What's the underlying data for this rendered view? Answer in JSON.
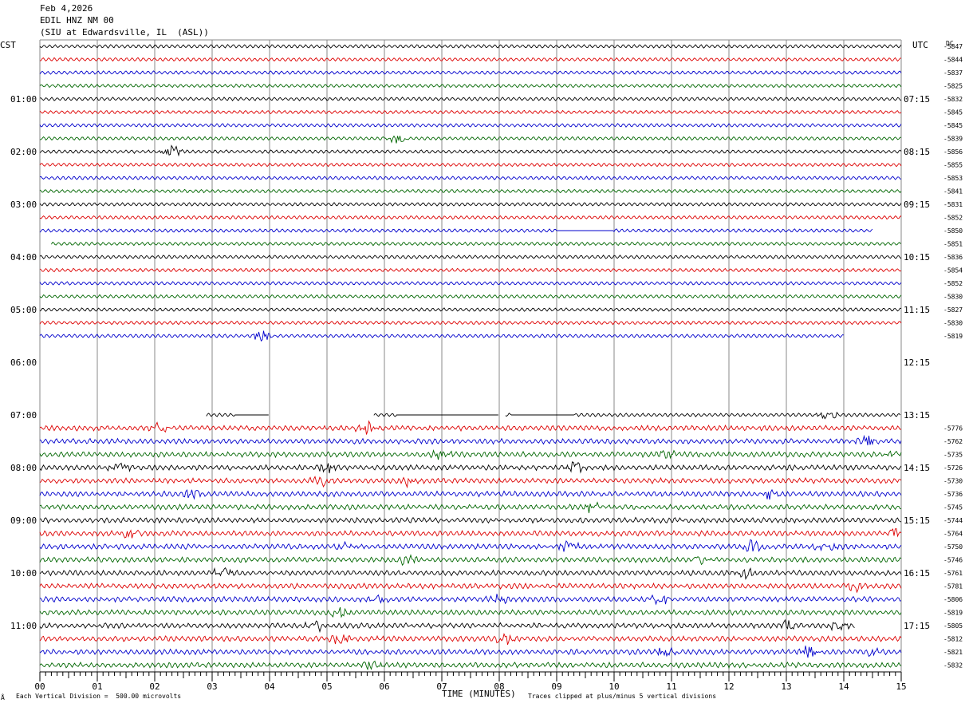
{
  "header": {
    "date": "Feb 4,2026",
    "channel": "EDIL HNZ NM 00",
    "station": "(SIU at Edwardsville, IL  (ASL))"
  },
  "left_tz": "CST",
  "right_tz": "UTC",
  "dc_label": "DC",
  "footer": {
    "scale_note": "Each Vertical Division =  500.00 microvolts",
    "xlabel": "TIME (MINUTES)",
    "clip_note": "Traces clipped at plus/minus 5 vertical divisions",
    "corner_mark": "Å"
  },
  "colors": {
    "black": "#000000",
    "red": "#dd0000",
    "blue": "#0000cc",
    "green": "#006600",
    "grid": "#888888"
  },
  "chart_data": {
    "type": "line",
    "title": "EDIL HNZ NM 00",
    "xlabel": "TIME (MINUTES)",
    "xlim": [
      0,
      15
    ],
    "x_ticks": [
      "00",
      "01",
      "02",
      "03",
      "04",
      "05",
      "06",
      "07",
      "08",
      "09",
      "10",
      "11",
      "12",
      "13",
      "14",
      "15"
    ],
    "left_hour_labels": [
      "01:00",
      "02:00",
      "03:00",
      "04:00",
      "05:00",
      "06:00",
      "07:00",
      "08:00",
      "09:00",
      "10:00",
      "11:00"
    ],
    "right_hour_labels": [
      "07:15",
      "08:15",
      "09:15",
      "10:15",
      "11:15",
      "12:15",
      "13:15",
      "14:15",
      "15:15",
      "16:15",
      "17:15"
    ],
    "trace_color_cycle": [
      "black",
      "red",
      "blue",
      "green"
    ],
    "traces": [
      {
        "row": 0,
        "dc": "-5847",
        "start": 0,
        "end": 15,
        "noise": "low"
      },
      {
        "row": 1,
        "dc": "-5844",
        "start": 0,
        "end": 15,
        "noise": "low"
      },
      {
        "row": 2,
        "dc": "-5837",
        "start": 0,
        "end": 15,
        "noise": "low"
      },
      {
        "row": 3,
        "dc": "-5825",
        "start": 0,
        "end": 15,
        "noise": "low"
      },
      {
        "row": 4,
        "dc": "-5832",
        "start": 0,
        "end": 15,
        "noise": "low"
      },
      {
        "row": 5,
        "dc": "-5845",
        "start": 0,
        "end": 15,
        "noise": "low"
      },
      {
        "row": 6,
        "dc": "-5845",
        "start": 0,
        "end": 15,
        "noise": "low"
      },
      {
        "row": 7,
        "dc": "-5839",
        "start": 0,
        "end": 15,
        "noise": "low",
        "events": [
          6.2
        ]
      },
      {
        "row": 8,
        "dc": "-5856",
        "start": 0,
        "end": 15,
        "noise": "low",
        "events": [
          2.3
        ]
      },
      {
        "row": 9,
        "dc": "-5855",
        "start": 0,
        "end": 15,
        "noise": "low"
      },
      {
        "row": 10,
        "dc": "-5853",
        "start": 0,
        "end": 15,
        "noise": "low"
      },
      {
        "row": 11,
        "dc": "-5841",
        "start": 0,
        "end": 15,
        "noise": "low"
      },
      {
        "row": 12,
        "dc": "-5831",
        "start": 0,
        "end": 15,
        "noise": "low"
      },
      {
        "row": 13,
        "dc": "-5852",
        "start": 0,
        "end": 15,
        "noise": "low"
      },
      {
        "row": 14,
        "dc": "-5850",
        "start": 0,
        "end": 14.5,
        "noise": "low",
        "flat": [
          [
            9,
            10
          ]
        ]
      },
      {
        "row": 15,
        "dc": "-5851",
        "start": 0.2,
        "end": 15,
        "noise": "low"
      },
      {
        "row": 16,
        "dc": "-5836",
        "start": 0,
        "end": 15,
        "noise": "low"
      },
      {
        "row": 17,
        "dc": "-5854",
        "start": 0,
        "end": 15,
        "noise": "low"
      },
      {
        "row": 18,
        "dc": "-5852",
        "start": 0,
        "end": 15,
        "noise": "low"
      },
      {
        "row": 19,
        "dc": "-5830",
        "start": 0,
        "end": 15,
        "noise": "low"
      },
      {
        "row": 20,
        "dc": "-5827",
        "start": 0,
        "end": 15,
        "noise": "low"
      },
      {
        "row": 21,
        "dc": "-5830",
        "start": 0,
        "end": 15,
        "noise": "low"
      },
      {
        "row": 22,
        "dc": "-5819",
        "start": 0,
        "end": 14.0,
        "noise": "low",
        "events": [
          3.9
        ]
      },
      {
        "row": 23,
        "dc": "",
        "start": 0,
        "end": 0,
        "noise": "none"
      },
      {
        "row": 24,
        "dc": "",
        "start": 0,
        "end": 0,
        "noise": "none"
      },
      {
        "row": 25,
        "dc": "",
        "start": 0,
        "end": 0,
        "noise": "none"
      },
      {
        "row": 26,
        "dc": "",
        "start": 0,
        "end": 0,
        "noise": "none"
      },
      {
        "row": 27,
        "dc": "",
        "start": 0,
        "end": 0,
        "noise": "none"
      },
      {
        "row": 28,
        "dc": "",
        "start": 2.9,
        "end": 15,
        "noise": "low",
        "flat": [
          [
            3.4,
            4.0
          ],
          [
            6.2,
            8.0
          ],
          [
            8.2,
            9.3
          ]
        ],
        "gaps": [
          [
            4.0,
            5.8
          ],
          [
            8.0,
            8.1
          ]
        ],
        "events": [
          13.7
        ]
      },
      {
        "row": 29,
        "dc": "-5776",
        "start": 0,
        "end": 15,
        "noise": "high",
        "events": [
          2.1,
          5.7
        ]
      },
      {
        "row": 30,
        "dc": "-5762",
        "start": 0,
        "end": 15,
        "noise": "high",
        "events": [
          14.4
        ]
      },
      {
        "row": 31,
        "dc": "-5735",
        "start": 0,
        "end": 15,
        "noise": "high",
        "events": [
          7.0,
          10.9,
          14.9
        ]
      },
      {
        "row": 32,
        "dc": "-5726",
        "start": 0,
        "end": 15,
        "noise": "high",
        "events": [
          1.4,
          5.0,
          9.3
        ]
      },
      {
        "row": 33,
        "dc": "-5730",
        "start": 0,
        "end": 15,
        "noise": "high",
        "events": [
          4.9,
          6.4
        ]
      },
      {
        "row": 34,
        "dc": "-5736",
        "start": 0,
        "end": 15,
        "noise": "high",
        "events": [
          2.7,
          12.7
        ]
      },
      {
        "row": 35,
        "dc": "-5745",
        "start": 0,
        "end": 15,
        "noise": "high",
        "events": [
          9.6
        ]
      },
      {
        "row": 36,
        "dc": "-5744",
        "start": 0,
        "end": 15,
        "noise": "high"
      },
      {
        "row": 37,
        "dc": "-5764",
        "start": 0,
        "end": 15,
        "noise": "high",
        "events": [
          1.6,
          14.9
        ]
      },
      {
        "row": 38,
        "dc": "-5750",
        "start": 0,
        "end": 15,
        "noise": "high",
        "events": [
          5.3,
          9.2,
          12.4,
          13.7
        ]
      },
      {
        "row": 39,
        "dc": "-5746",
        "start": 0,
        "end": 15,
        "noise": "high",
        "events": [
          6.4,
          11.5
        ]
      },
      {
        "row": 40,
        "dc": "-5761",
        "start": 0,
        "end": 15,
        "noise": "high",
        "events": [
          3.2,
          12.3
        ]
      },
      {
        "row": 41,
        "dc": "-5781",
        "start": 0,
        "end": 15,
        "noise": "high",
        "events": [
          14.2
        ]
      },
      {
        "row": 42,
        "dc": "-5806",
        "start": 0,
        "end": 15,
        "noise": "high",
        "events": [
          5.9,
          8.0,
          10.8
        ]
      },
      {
        "row": 43,
        "dc": "-5819",
        "start": 0,
        "end": 15,
        "noise": "high",
        "events": [
          5.2
        ]
      },
      {
        "row": 44,
        "dc": "-5805",
        "start": 0,
        "end": 14.2,
        "noise": "high",
        "events": [
          4.8,
          13.0,
          13.9
        ]
      },
      {
        "row": 45,
        "dc": "-5812",
        "start": 0,
        "end": 15,
        "noise": "high",
        "events": [
          5.2,
          8.1
        ]
      },
      {
        "row": 46,
        "dc": "-5821",
        "start": 0,
        "end": 15,
        "noise": "high",
        "events": [
          10.9,
          13.4,
          14.4
        ]
      },
      {
        "row": 47,
        "dc": "-5832",
        "start": 0,
        "end": 15,
        "noise": "high",
        "events": [
          5.8
        ]
      }
    ]
  }
}
